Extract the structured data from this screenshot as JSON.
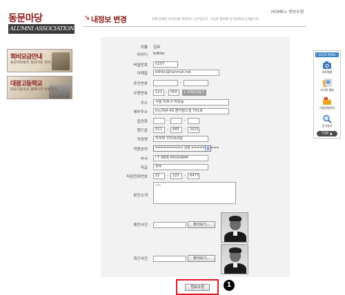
{
  "sidebar": {
    "logo_kr": "동문마당",
    "logo_en": "ALUMNI ASSOCIATION",
    "banners": [
      {
        "title": "회비모금안내",
        "subtitle": "동문여러분의 정성어린 회비..."
      },
      {
        "title": "대광고등학교",
        "subtitle": "대광고등학교 홈페이지 바로가기"
      }
    ]
  },
  "header": {
    "title_mark": "↘",
    "title": "내정보 변경",
    "description": "현재 등록된 내 정보를 변경하는 공간입니다. 기입된 정보를 동기들에게 공개합니다.",
    "breadcrumb": "HOME> 정보수정"
  },
  "form": {
    "name": {
      "label": "이름",
      "value": "김보"
    },
    "user_id": {
      "label": "아이디",
      "value": "kdhbc"
    },
    "password": {
      "label": "비밀번호",
      "value": "0207"
    },
    "email": {
      "label": "이메일",
      "value": "kdhbc@hanmail.net"
    },
    "resident_no": {
      "label": "주민번호",
      "part1": "",
      "part2": ""
    },
    "postal_code": {
      "label": "우편번호",
      "part1": "121",
      "part2": "050",
      "button": "우편번호찾기"
    },
    "address": {
      "label": "주소",
      "value": "서울 마포구 마포동"
    },
    "detail_address": {
      "label": "세부주소",
      "value": "tiry394-45 명지빌드월 701호"
    },
    "home_phone": {
      "label": "집전화",
      "parts": [
        "",
        "",
        ""
      ]
    },
    "mobile": {
      "label": "핸드폰",
      "parts": [
        "011",
        "685",
        "2021"
      ]
    },
    "company": {
      "label": "직장명",
      "value": "리미텍 인터네셔널"
    },
    "job_field": {
      "label": "직종분야",
      "selected": "========== 선택 =========="
    },
    "department": {
      "label": "부서",
      "value": "I.T WEB PROGRAM"
    },
    "position": {
      "label": "직급",
      "value": "전무"
    },
    "work_phone": {
      "label": "직장전화번호",
      "parts": [
        "02",
        "325",
        "6477"
      ]
    },
    "intro": {
      "label": "본인소개",
      "value": "sss"
    },
    "old_photo": {
      "label": "예전사진",
      "button": "찾아보기..."
    },
    "recent_photo": {
      "label": "최근사진",
      "button": "찾아보기..."
    },
    "submit": "정보수정"
  },
  "callout": "1",
  "quick_menu": {
    "header": "QUICK MENU",
    "items": [
      {
        "label": "포토앨범",
        "icon": "camera-icon"
      },
      {
        "label": "추억의 앨범",
        "icon": "album-icon"
      },
      {
        "label": "이용방법안내",
        "icon": "folder-icon"
      },
      {
        "label": "동기찾기",
        "icon": "magnifier-icon"
      }
    ],
    "top": "TOP ▲"
  }
}
